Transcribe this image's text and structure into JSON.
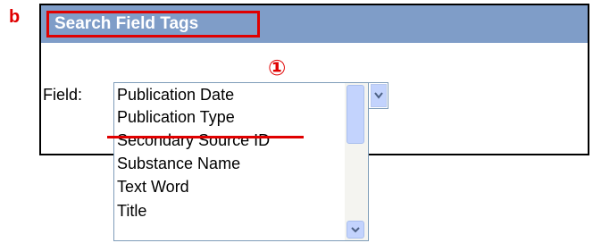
{
  "panel_label": "b",
  "header": {
    "title": "Search Field Tags"
  },
  "annotation": {
    "step_marker": "①"
  },
  "field": {
    "label": "Field:",
    "options": [
      "Publication Date",
      "Publication Type",
      "Secondary Source ID",
      "Substance Name",
      "Text Word",
      "Title"
    ],
    "highlighted_option": "Publication Type"
  },
  "colors": {
    "header_bg": "#7f9dc8",
    "annotation_red": "#e00000",
    "scrollbar_blue": "#c3d3fd"
  },
  "icons": {
    "dropdown": "chevron-down-icon",
    "scroll_down": "chevron-down-icon"
  }
}
